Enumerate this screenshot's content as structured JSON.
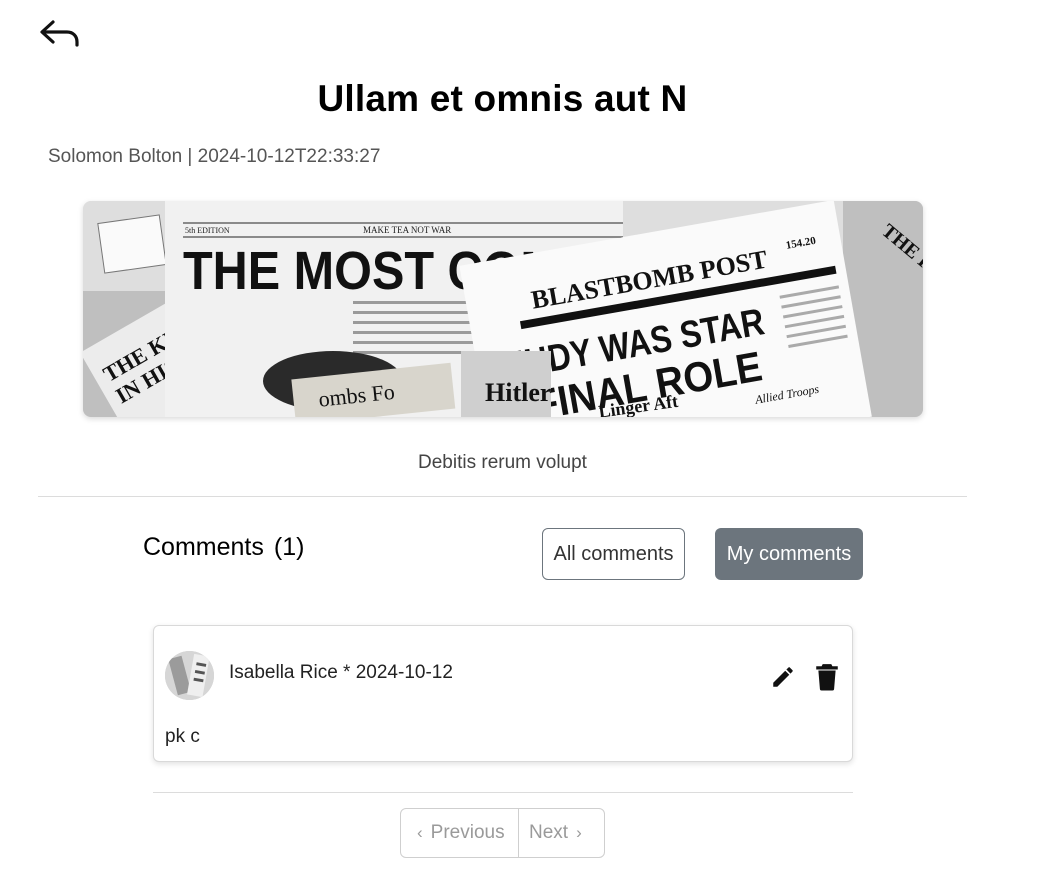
{
  "post": {
    "title": "Ullam et omnis aut N",
    "meta": "Solomon Bolton | 2024-10-12T22:33:27",
    "caption": "Debitis rerum volupt",
    "image": {
      "masthead": "MAKE TEA NOT WAR",
      "edition": "5th EDITION",
      "headline1": "THE MOST COMPL",
      "paper2": "BLASTBOMB POST",
      "headline2a": "JUDY WAS STAR",
      "headline2b": "FINAL ROLE",
      "side1": "THE KING D",
      "side2": "IN HIS SLEE",
      "side3": "THE K",
      "snippet1": "ombs Fo",
      "snippet2": "Hitler",
      "snippet3": "Linger Aft",
      "snippet4": "Allied Troops",
      "price": "154.20"
    }
  },
  "comments": {
    "label": "Comments",
    "count": "(1)",
    "filter_all": "All comments",
    "filter_mine": "My comments",
    "items": [
      {
        "author_date": "Isabella Rice * 2024-10-12",
        "text": "pk c"
      }
    ]
  },
  "pagination": {
    "previous": "Previous",
    "next": "Next"
  },
  "icons": {
    "back": "back-arrow-icon",
    "edit": "pencil-icon",
    "delete": "trash-icon"
  },
  "colors": {
    "active_filter": "#6c757d"
  }
}
